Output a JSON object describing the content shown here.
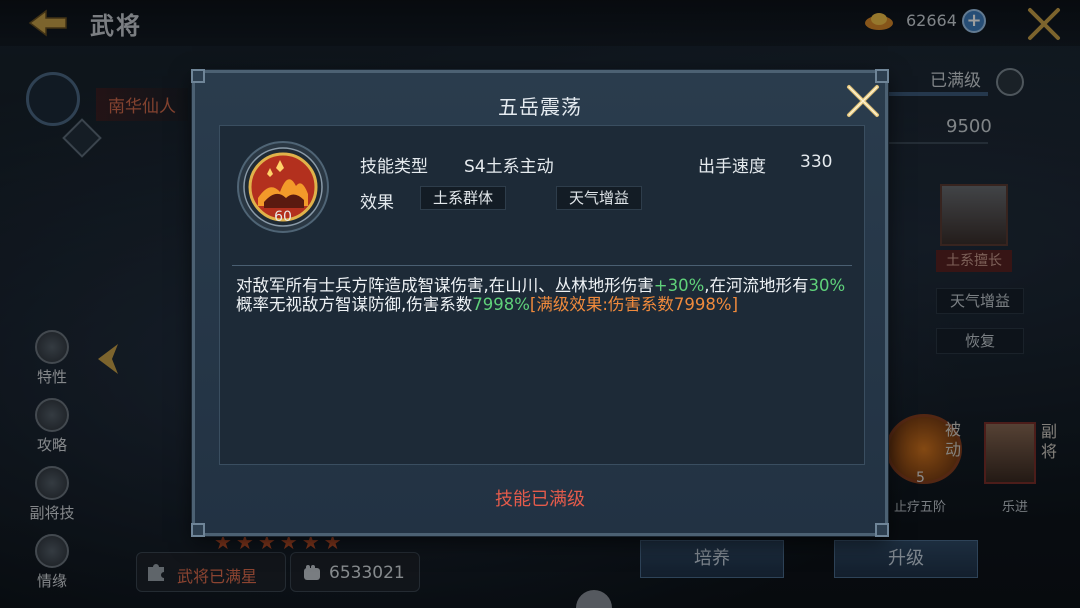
{
  "topbar": {
    "title": "武将",
    "currency_value": "62664",
    "plus_label": "+"
  },
  "hero": {
    "name": "南华仙人"
  },
  "side_nav": [
    {
      "label": "特性"
    },
    {
      "label": "攻略"
    },
    {
      "label": "副将技"
    },
    {
      "label": "情缘"
    }
  ],
  "bottom_left": {
    "star_status": "武将已满星",
    "power": "6533021"
  },
  "right_panel": {
    "level_status": "已满级",
    "value": "9500",
    "card_label": "土系擅长",
    "tags": [
      "天气增益",
      "恢复"
    ],
    "passive": {
      "badge": "被动",
      "level": "5",
      "name": "止疗五阶"
    },
    "deputy": {
      "badge": "副将",
      "name": "乐进"
    }
  },
  "buttons": {
    "train": "培养",
    "upgrade": "升级"
  },
  "modal": {
    "title": "五岳震荡",
    "skill_level": "60",
    "type_label": "技能类型",
    "type_value": "S4土系主动",
    "speed_label": "出手速度",
    "speed_value": "330",
    "effect_label": "效果",
    "effect_tags": [
      "土系群体",
      "天气增益"
    ],
    "description": {
      "p1": "对敌军所有士兵方阵造成智谋伤害,在山川、丛林地形伤害",
      "g1": "+30%",
      "p2": ",在河流地形有",
      "g2": "30%",
      "p3": "概率无视敌方智谋防御,伤害系数",
      "g3": "7998%",
      "o1": "[满级效果:伤害系数7998%]"
    },
    "status": "技能已满级"
  },
  "colors": {
    "accent_red": "#e45b4b",
    "green_highlight": "#5fd17a",
    "orange_highlight": "#f08a3c",
    "panel_bg": "#223243"
  }
}
